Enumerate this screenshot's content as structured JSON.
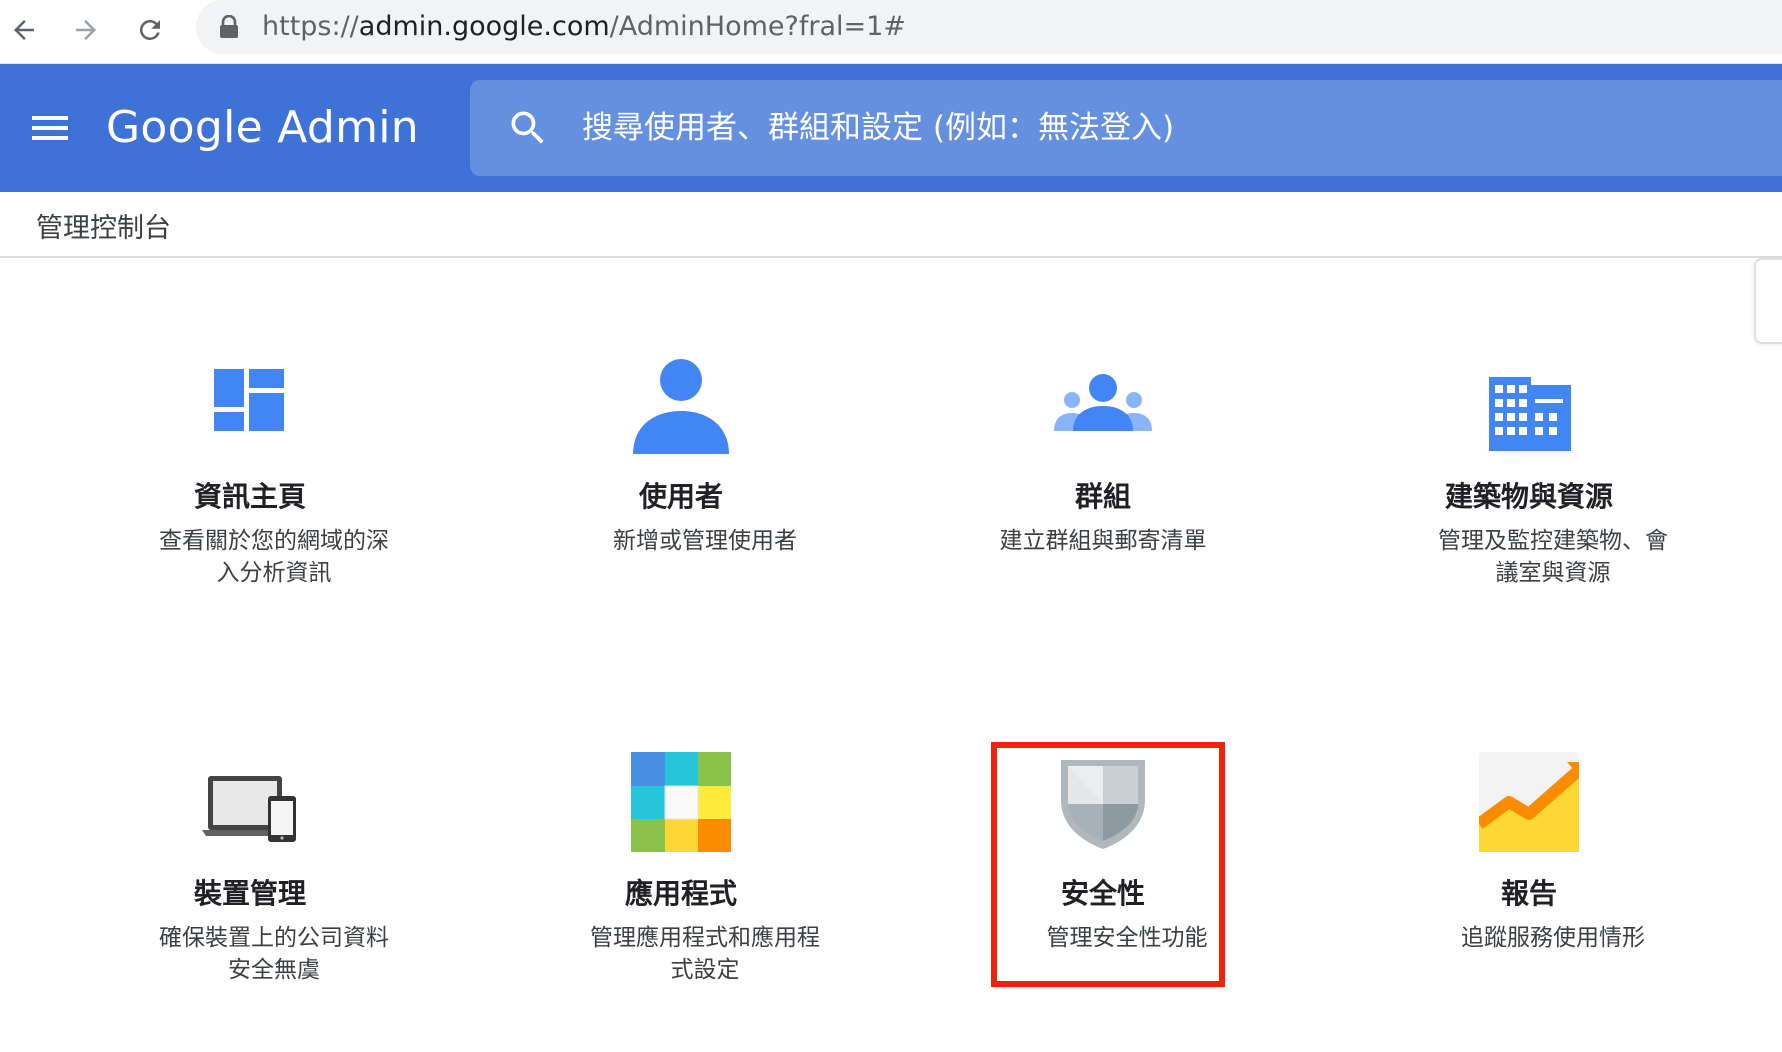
{
  "browser": {
    "url_scheme": "https://",
    "url_host": "admin.google.com",
    "url_path": "/AdminHome?fral=1#"
  },
  "header": {
    "brand": "Google Admin",
    "search_placeholder": "搜尋使用者、群組和設定 (例如：無法登入)"
  },
  "breadcrumb": "管理控制台",
  "cards": [
    {
      "title": "資訊主頁",
      "desc": "查看關於您的網域的深入分析資訊",
      "icon": "dashboard-icon"
    },
    {
      "title": "使用者",
      "desc": "新增或管理使用者",
      "icon": "user-icon"
    },
    {
      "title": "群組",
      "desc": "建立群組與郵寄清單",
      "icon": "groups-icon"
    },
    {
      "title": "建築物與資源",
      "desc": "管理及監控建築物、會議室與資源",
      "icon": "building-icon"
    },
    {
      "title": "裝置管理",
      "desc": "確保裝置上的公司資料安全無虞",
      "icon": "devices-icon"
    },
    {
      "title": "應用程式",
      "desc": "管理應用程式和應用程式設定",
      "icon": "apps-icon"
    },
    {
      "title": "安全性",
      "desc": "管理安全性功能",
      "icon": "shield-icon"
    },
    {
      "title": "報告",
      "desc": "追蹤服務使用情形",
      "icon": "reports-icon"
    }
  ],
  "colors": {
    "header_bg": "#3f72d6",
    "search_bg": "#6590e0",
    "icon_blue": "#4285f4",
    "highlight": "#f4210b"
  }
}
